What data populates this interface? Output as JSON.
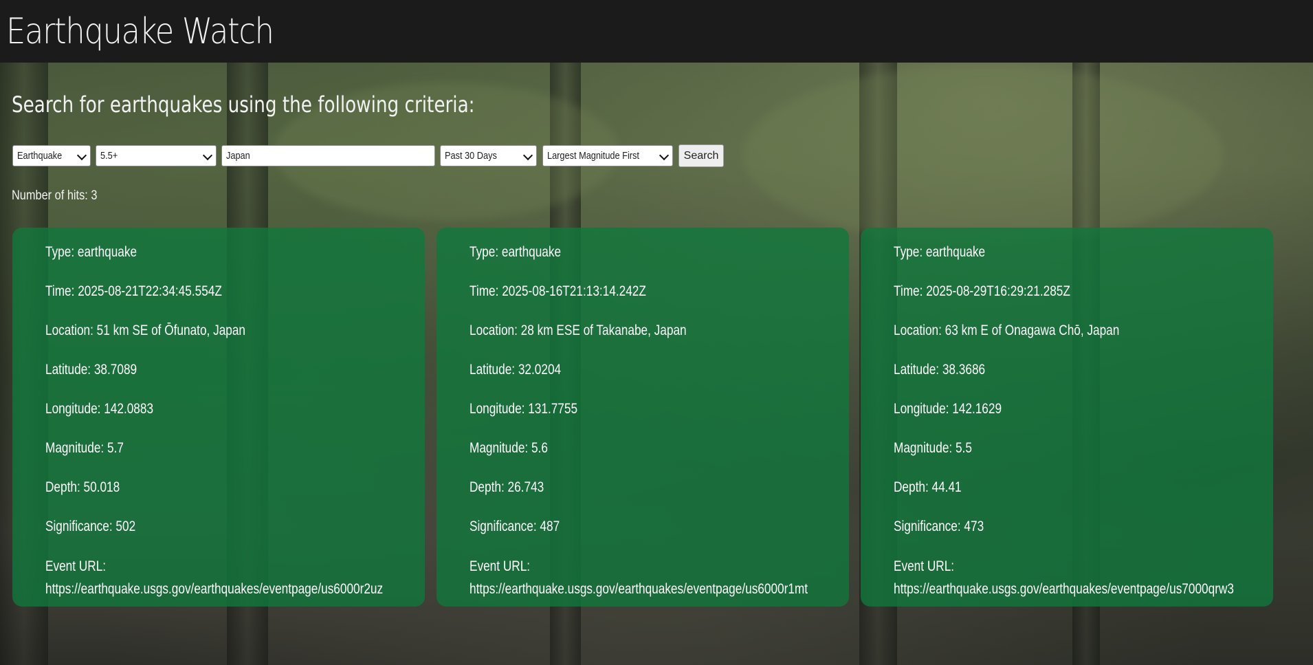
{
  "app": {
    "title": "Earthquake Watch"
  },
  "search": {
    "heading": "Search for earthquakes using the following criteria:",
    "event_type": "Earthquake",
    "magnitude": "5.5+",
    "location_value": "Japan",
    "time_range": "Past 30 Days",
    "sort_order": "Largest Magnitude First",
    "search_label": "Search"
  },
  "results": {
    "hits_label": "Number of hits: 3",
    "cards": [
      {
        "type": "Type: earthquake",
        "time": "Time: 2025-08-21T22:34:45.554Z",
        "location": "Location: 51 km SE of Ōfunato, Japan",
        "latitude": "Latitude: 38.7089",
        "longitude": "Longitude: 142.0883",
        "magnitude": "Magnitude: 5.7",
        "depth": "Depth: 50.018",
        "significance": "Significance: 502",
        "url_label": "Event URL:",
        "url": "https://earthquake.usgs.gov/earthquakes/eventpage/us6000r2uz"
      },
      {
        "type": "Type: earthquake",
        "time": "Time: 2025-08-16T21:13:14.242Z",
        "location": "Location: 28 km ESE of Takanabe, Japan",
        "latitude": "Latitude: 32.0204",
        "longitude": "Longitude: 131.7755",
        "magnitude": "Magnitude: 5.6",
        "depth": "Depth: 26.743",
        "significance": "Significance: 487",
        "url_label": "Event URL:",
        "url": "https://earthquake.usgs.gov/earthquakes/eventpage/us6000r1mt"
      },
      {
        "type": "Type: earthquake",
        "time": "Time: 2025-08-29T16:29:21.285Z",
        "location": "Location: 63 km E of Onagawa Chō, Japan",
        "latitude": "Latitude: 38.3686",
        "longitude": "Longitude: 142.1629",
        "magnitude": "Magnitude: 5.5",
        "depth": "Depth: 44.41",
        "significance": "Significance: 473",
        "url_label": "Event URL:",
        "url": "https://earthquake.usgs.gov/earthquakes/eventpage/us7000qrw3"
      }
    ]
  },
  "colors": {
    "header_bg": "#1b1b1b",
    "card_bg": "#10783c",
    "text": "#ffffff"
  }
}
